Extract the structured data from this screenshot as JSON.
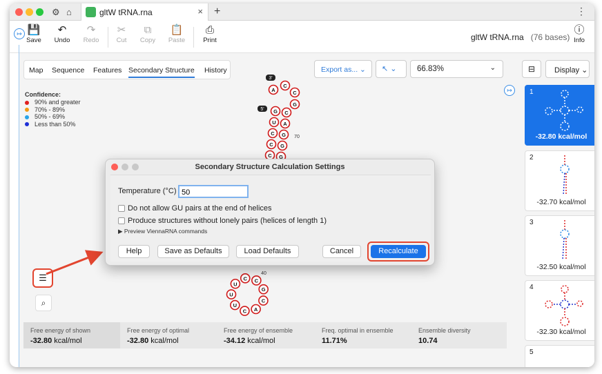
{
  "window": {
    "tab_title": "gltW tRNA.rna",
    "file_name": "gltW tRNA.rna",
    "base_count": "(76 bases)"
  },
  "toolbar": {
    "save": "Save",
    "undo": "Undo",
    "redo": "Redo",
    "cut": "Cut",
    "copy": "Copy",
    "paste": "Paste",
    "print": "Print",
    "info": "Info"
  },
  "view_tabs": [
    "Map",
    "Sequence",
    "Features",
    "Secondary Structure",
    "History"
  ],
  "active_tab": "Secondary Structure",
  "controls": {
    "export": "Export as...",
    "zoom": "66.83%",
    "display": "Display"
  },
  "legend": {
    "title": "Confidence:",
    "items": [
      {
        "label": "90% and greater",
        "color": "#e01f1f"
      },
      {
        "label": "70% - 89%",
        "color": "#f39a12"
      },
      {
        "label": "50% - 69%",
        "color": "#28a3e8"
      },
      {
        "label": "Less than 50%",
        "color": "#1f2fd6"
      }
    ]
  },
  "structure": {
    "labels": {
      "three_prime": "3'",
      "five_prime": "5'",
      "pos70": "70",
      "pos40": "40"
    },
    "stem_left": [
      "G",
      "U",
      "C",
      "C",
      "C"
    ],
    "stem_right": [
      "C",
      "A",
      "G",
      "G",
      "G"
    ],
    "top": [
      "A",
      "C",
      "C",
      "G"
    ],
    "loop": [
      "C",
      "C",
      "G",
      "C",
      "A",
      "C",
      "U",
      "U",
      "U"
    ]
  },
  "stats": [
    {
      "label": "Free energy of shown",
      "value": "-32.80",
      "unit": "kcal/mol"
    },
    {
      "label": "Free energy of optimal",
      "value": "-32.80",
      "unit": "kcal/mol"
    },
    {
      "label": "Free energy of ensemble",
      "value": "-34.12",
      "unit": "kcal/mol"
    },
    {
      "label": "Freq. optimal in ensemble",
      "value": "11.71%",
      "unit": ""
    },
    {
      "label": "Ensemble diversity",
      "value": "10.74",
      "unit": ""
    }
  ],
  "structures": [
    {
      "num": "1",
      "energy": "-32.80 kcal/mol"
    },
    {
      "num": "2",
      "energy": "-32.70 kcal/mol"
    },
    {
      "num": "3",
      "energy": "-32.50 kcal/mol"
    },
    {
      "num": "4",
      "energy": "-32.30 kcal/mol"
    },
    {
      "num": "5",
      "energy": ""
    }
  ],
  "dialog": {
    "title": "Secondary Structure Calculation Settings",
    "temperature_label": "Temperature (°C)",
    "temperature_value": "50",
    "option_gu": "Do not allow GU pairs at the end of helices",
    "option_lonely": "Produce structures without lonely pairs (helices of length 1)",
    "preview": "Preview ViennaRNA commands",
    "help": "Help",
    "save_defaults": "Save as Defaults",
    "load_defaults": "Load Defaults",
    "cancel": "Cancel",
    "recalculate": "Recalculate"
  }
}
